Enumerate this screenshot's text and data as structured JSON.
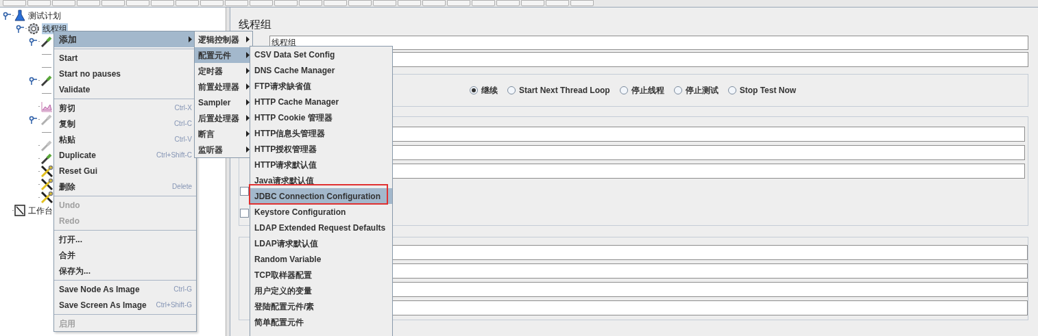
{
  "tree": {
    "nodes": [
      {
        "label": "测试计划",
        "kind": "plan",
        "expanded": true,
        "selected": false,
        "children": [
          {
            "label": "线程组",
            "kind": "thread_group",
            "expanded": true,
            "selected": true,
            "children": [
              {
                "kind": "sampler",
                "expanded": true,
                "children": [
                  {
                    "kind": "element"
                  },
                  {
                    "kind": "element"
                  }
                ]
              },
              {
                "kind": "sampler",
                "expanded": true,
                "children": [
                  {
                    "kind": "element"
                  }
                ]
              },
              {
                "kind": "chart",
                "expanded": false
              },
              {
                "kind": "sampler_gray",
                "expanded": true,
                "children": [
                  {
                    "kind": "element"
                  }
                ]
              },
              {
                "kind": "sampler_gray",
                "expanded": false
              },
              {
                "kind": "sampler",
                "expanded": false
              },
              {
                "kind": "tools",
                "expanded": false
              },
              {
                "kind": "tools",
                "expanded": false
              },
              {
                "kind": "tools",
                "expanded": false
              }
            ]
          }
        ]
      },
      {
        "label": "工作台",
        "kind": "workbench",
        "expanded": false,
        "selected": false
      }
    ]
  },
  "context_menu": {
    "items": [
      {
        "kind": "item",
        "label": "添加",
        "submenu": true,
        "selected": true,
        "disabled": false
      },
      {
        "kind": "separator"
      },
      {
        "kind": "item",
        "label": "Start",
        "selected": false,
        "disabled": false
      },
      {
        "kind": "item",
        "label": "Start no pauses",
        "selected": false,
        "disabled": false
      },
      {
        "kind": "item",
        "label": "Validate",
        "selected": false,
        "disabled": false
      },
      {
        "kind": "separator"
      },
      {
        "kind": "item",
        "label": "剪切",
        "shortcut": "Ctrl-X",
        "selected": false,
        "disabled": false
      },
      {
        "kind": "item",
        "label": "复制",
        "shortcut": "Ctrl-C",
        "selected": false,
        "disabled": false
      },
      {
        "kind": "item",
        "label": "粘贴",
        "shortcut": "Ctrl-V",
        "selected": false,
        "disabled": false
      },
      {
        "kind": "item",
        "label": "Duplicate",
        "shortcut": "Ctrl+Shift-C",
        "selected": false,
        "disabled": false
      },
      {
        "kind": "item",
        "label": "Reset Gui",
        "selected": false,
        "disabled": false
      },
      {
        "kind": "item",
        "label": "删除",
        "shortcut": "Delete",
        "selected": false,
        "disabled": false
      },
      {
        "kind": "separator"
      },
      {
        "kind": "item",
        "label": "Undo",
        "selected": false,
        "disabled": true
      },
      {
        "kind": "item",
        "label": "Redo",
        "selected": false,
        "disabled": true
      },
      {
        "kind": "separator"
      },
      {
        "kind": "item",
        "label": "打开...",
        "selected": false,
        "disabled": false
      },
      {
        "kind": "item",
        "label": "合并",
        "selected": false,
        "disabled": false
      },
      {
        "kind": "item",
        "label": "保存为...",
        "selected": false,
        "disabled": false
      },
      {
        "kind": "separator"
      },
      {
        "kind": "item",
        "label": "Save Node As Image",
        "shortcut": "Ctrl-G",
        "selected": false,
        "disabled": false
      },
      {
        "kind": "item",
        "label": "Save Screen As Image",
        "shortcut": "Ctrl+Shift-G",
        "selected": false,
        "disabled": false
      },
      {
        "kind": "separator"
      },
      {
        "kind": "item",
        "label": "启用",
        "selected": false,
        "disabled": true
      }
    ]
  },
  "add_submenu": {
    "items": [
      {
        "label": "逻辑控制器",
        "submenu": true,
        "selected": false
      },
      {
        "label": "配置元件",
        "submenu": true,
        "selected": true
      },
      {
        "label": "定时器",
        "submenu": true,
        "selected": false
      },
      {
        "label": "前置处理器",
        "submenu": true,
        "selected": false
      },
      {
        "label": "Sampler",
        "submenu": true,
        "selected": false
      },
      {
        "label": "后置处理器",
        "submenu": true,
        "selected": false
      },
      {
        "label": "断言",
        "submenu": true,
        "selected": false
      },
      {
        "label": "监听器",
        "submenu": true,
        "selected": false
      }
    ]
  },
  "config_submenu": {
    "items": [
      {
        "label": "CSV Data Set Config",
        "selected": false,
        "outlined": false
      },
      {
        "label": "DNS Cache Manager",
        "selected": false,
        "outlined": false
      },
      {
        "label": "FTP请求缺省值",
        "selected": false,
        "outlined": false
      },
      {
        "label": "HTTP Cache Manager",
        "selected": false,
        "outlined": false
      },
      {
        "label": "HTTP Cookie 管理器",
        "selected": false,
        "outlined": false
      },
      {
        "label": "HTTP信息头管理器",
        "selected": false,
        "outlined": false
      },
      {
        "label": "HTTP授权管理器",
        "selected": false,
        "outlined": false
      },
      {
        "label": "HTTP请求默认值",
        "selected": false,
        "outlined": false
      },
      {
        "label": "Java请求默认值",
        "selected": false,
        "outlined": false
      },
      {
        "label": "JDBC Connection Configuration",
        "selected": true,
        "outlined": true
      },
      {
        "label": "Keystore Configuration",
        "selected": false,
        "outlined": false
      },
      {
        "label": "LDAP Extended Request Defaults",
        "selected": false,
        "outlined": false
      },
      {
        "label": "LDAP请求默认值",
        "selected": false,
        "outlined": false
      },
      {
        "label": "Random Variable",
        "selected": false,
        "outlined": false
      },
      {
        "label": "TCP取样器配置",
        "selected": false,
        "outlined": false
      },
      {
        "label": "用户定义的变量",
        "selected": false,
        "outlined": false
      },
      {
        "label": "登陆配置元件/素",
        "selected": false,
        "outlined": false
      },
      {
        "label": "简单配置元件",
        "selected": false,
        "outlined": false
      }
    ]
  },
  "panel": {
    "title": "线程组",
    "name_field": {
      "value": "线程组"
    },
    "error_action": [
      {
        "label": "继续",
        "selected": true
      },
      {
        "label": "Start Next Thread Loop",
        "selected": false
      },
      {
        "label": "停止线程",
        "selected": false
      },
      {
        "label": "停止测试",
        "selected": false
      },
      {
        "label": "Stop Test Now",
        "selected": false
      }
    ],
    "thread_properties": {
      "rows": [
        {
          "kind": "field"
        },
        {
          "kind": "field"
        },
        {
          "kind": "field"
        },
        {
          "kind": "checkbox",
          "checked": false
        },
        {
          "kind": "checkbox",
          "checked": false
        }
      ]
    },
    "scheduler": {
      "rows": [
        {
          "kind": "field"
        },
        {
          "kind": "field"
        },
        {
          "kind": "field"
        },
        {
          "kind": "field"
        }
      ]
    }
  }
}
